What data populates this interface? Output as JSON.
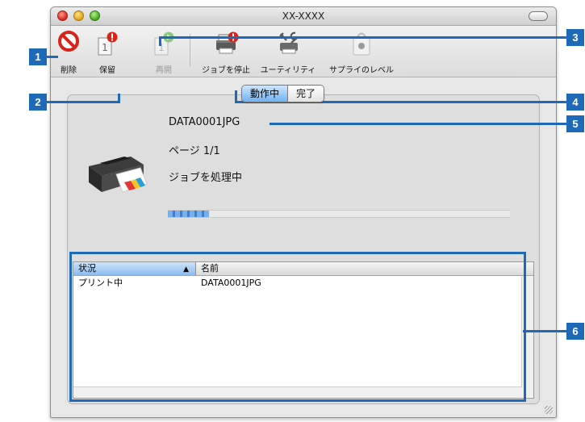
{
  "window": {
    "title": "XX-XXXX"
  },
  "toolbar": {
    "delete_label": "削除",
    "hold_label": "保留",
    "resume_label": "再開",
    "stop_jobs_label": "ジョブを停止",
    "utility_label": "ユーティリティ",
    "supply_label": "サプライのレベル",
    "badge_number": "1"
  },
  "tabs": {
    "active": "動作中",
    "done": "完了"
  },
  "job": {
    "name": "DATA0001JPG",
    "page": "ページ 1/1",
    "status": "ジョブを処理中",
    "progress": 0.12
  },
  "list": {
    "columns": {
      "status": "状況",
      "sort_indicator": "▲",
      "name": "名前"
    },
    "rows": [
      {
        "status": "プリント中",
        "name": "DATA0001JPG"
      }
    ]
  },
  "callouts": [
    "1",
    "2",
    "3",
    "4",
    "5",
    "6"
  ],
  "colors": {
    "callout": "#1f6ab8",
    "alert": "#d8231b",
    "resume": "#3cab2e"
  }
}
